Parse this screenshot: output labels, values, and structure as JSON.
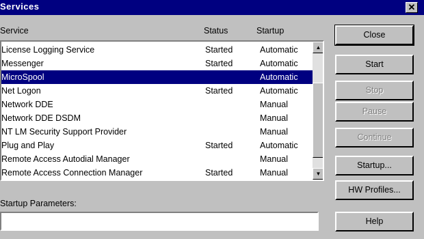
{
  "window": {
    "title": "Services",
    "close_glyph": "✕"
  },
  "columns": {
    "service": "Service",
    "status": "Status",
    "startup": "Startup"
  },
  "services": [
    {
      "name": "License Logging Service",
      "status": "Started",
      "startup": "Automatic"
    },
    {
      "name": "Messenger",
      "status": "Started",
      "startup": "Automatic"
    },
    {
      "name": "MicroSpool",
      "status": "",
      "startup": "Automatic"
    },
    {
      "name": "Net Logon",
      "status": "Started",
      "startup": "Automatic"
    },
    {
      "name": "Network DDE",
      "status": "",
      "startup": "Manual"
    },
    {
      "name": "Network DDE DSDM",
      "status": "",
      "startup": "Manual"
    },
    {
      "name": "NT LM Security Support Provider",
      "status": "",
      "startup": "Manual"
    },
    {
      "name": "Plug and Play",
      "status": "Started",
      "startup": "Automatic"
    },
    {
      "name": "Remote Access Autodial Manager",
      "status": "",
      "startup": "Manual"
    },
    {
      "name": "Remote Access Connection Manager",
      "status": "Started",
      "startup": "Manual"
    }
  ],
  "selected_index": 2,
  "buttons": {
    "close": "Close",
    "start": "Start",
    "stop": "Stop",
    "pause": "Pause",
    "continue": "Continue",
    "startup": "Startup...",
    "hw_profiles": "HW Profiles...",
    "help": "Help"
  },
  "startup_parameters": {
    "label": "Startup Parameters:",
    "value": ""
  },
  "scroll_up_glyph": "▲",
  "scroll_down_glyph": "▼"
}
